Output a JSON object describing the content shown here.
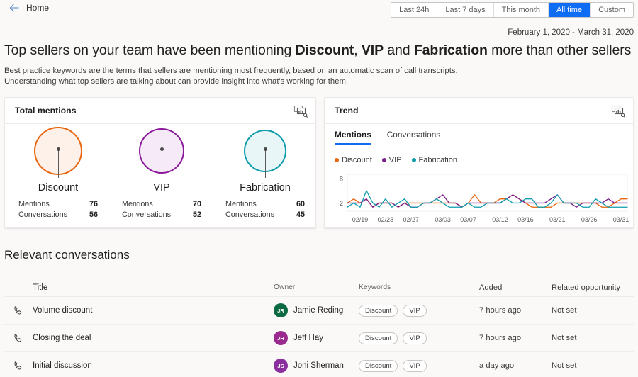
{
  "topbar": {
    "back_label": "Home",
    "back_icon": "arrow-left-icon",
    "date_filters": [
      {
        "label": "Last 24h",
        "active": false
      },
      {
        "label": "Last 7 days",
        "active": false
      },
      {
        "label": "This month",
        "active": false
      },
      {
        "label": "All time",
        "active": true
      },
      {
        "label": "Custom",
        "active": false
      }
    ],
    "date_range": "February 1, 2020 - March 31, 2020",
    "accent_color": "#0f6cf5"
  },
  "headline": {
    "prefix": "Top sellers on your team have been mentioning ",
    "kw1": "Discount",
    "sep1": ", ",
    "kw2": "VIP",
    "sep2": " and ",
    "kw3": "Fabrication",
    "suffix": " more than other sellers"
  },
  "subtext": {
    "line1": "Best practice keywords are the terms that sellers are mentioning most frequently, based on an automatic scan of call transcripts.",
    "line2": "Understanding what top sellers are talking about can provide insight into what's working for them."
  },
  "total_mentions_card": {
    "title": "Total mentions",
    "action_icon": "copy-chart-icon",
    "labels": {
      "mentions": "Mentions",
      "conversations": "Conversations"
    },
    "keywords": [
      {
        "name": "Discount",
        "mentions": 76,
        "conversations": 56,
        "color": "#e8650d",
        "fill": "#fdf1ea",
        "size": 68
      },
      {
        "name": "VIP",
        "mentions": 70,
        "conversations": 52,
        "color": "#8b1a9b",
        "fill": "#f6eaf8",
        "size": 64
      },
      {
        "name": "Fabrication",
        "mentions": 60,
        "conversations": 45,
        "color": "#0f9dac",
        "fill": "#e8f6f8",
        "size": 60
      }
    ]
  },
  "trend_card": {
    "title": "Trend",
    "action_icon": "copy-chart-icon",
    "tabs": [
      {
        "label": "Mentions",
        "active": true
      },
      {
        "label": "Conversations",
        "active": false
      }
    ]
  },
  "chart_data": {
    "type": "line",
    "title": "Trend",
    "xlabel": "",
    "ylabel": "",
    "ylim": [
      0,
      9
    ],
    "yticks": [
      2,
      8
    ],
    "grid": false,
    "legend_position": "top-left",
    "x": [
      "02/17",
      "02/18",
      "02/19",
      "02/20",
      "02/21",
      "02/22",
      "02/23",
      "02/24",
      "02/25",
      "02/26",
      "02/27",
      "02/28",
      "02/29",
      "03/01",
      "03/02",
      "03/03",
      "03/04",
      "03/05",
      "03/06",
      "03/07",
      "03/08",
      "03/09",
      "03/10",
      "03/11",
      "03/12",
      "03/13",
      "03/14",
      "03/15",
      "03/16",
      "03/17",
      "03/18",
      "03/19",
      "03/20",
      "03/21",
      "03/22",
      "03/23",
      "03/24",
      "03/25",
      "03/26",
      "03/27",
      "03/28",
      "03/29",
      "03/30",
      "03/31",
      "04/01"
    ],
    "xticks": [
      "02/19",
      "02/23",
      "02/27",
      "03/03",
      "03/07",
      "03/12",
      "03/16",
      "03/21",
      "03/26",
      "03/31"
    ],
    "series": [
      {
        "name": "Discount",
        "color": "#e8650d",
        "values": [
          2,
          3,
          2,
          3,
          1,
          2,
          2,
          2,
          1,
          2,
          2,
          2,
          2,
          2,
          2,
          2,
          2,
          2,
          1,
          2,
          4,
          2,
          2,
          2,
          3,
          3,
          4,
          3,
          2,
          1,
          1,
          1,
          1,
          2,
          2,
          2,
          2,
          2,
          2,
          2,
          1,
          1,
          2,
          3,
          3
        ]
      },
      {
        "name": "VIP",
        "color": "#7a1b8c",
        "values": [
          2,
          2,
          2,
          3,
          1,
          2,
          2,
          2,
          1,
          2,
          1,
          1,
          2,
          2,
          3,
          4,
          2,
          2,
          1,
          2,
          2,
          2,
          2,
          2,
          2,
          3,
          4,
          3,
          2,
          2,
          2,
          2,
          3,
          4,
          2,
          2,
          1,
          2,
          2,
          2,
          2,
          3,
          2,
          2,
          2
        ]
      },
      {
        "name": "Fabrication",
        "color": "#0f9dac",
        "values": [
          1,
          2,
          1,
          5,
          2,
          1,
          3,
          1,
          2,
          3,
          1,
          1,
          2,
          2,
          3,
          2,
          1,
          1,
          1,
          2,
          1,
          1,
          2,
          2,
          2,
          3,
          2,
          2,
          3,
          3,
          1,
          1,
          2,
          4,
          2,
          2,
          2,
          1,
          1,
          3,
          2,
          1,
          1,
          1,
          1
        ]
      }
    ]
  },
  "table": {
    "section_title": "Relevant conversations",
    "columns": [
      "Title",
      "Owner",
      "Keywords",
      "Added",
      "Related opportunity"
    ],
    "rows": [
      {
        "icon": "phone-icon",
        "title": "Volume discount",
        "owner": "Jamie Reding",
        "initials": "JR",
        "avatar_color": "#0b6a41",
        "keywords": [
          "Discount",
          "VIP"
        ],
        "added": "7 hours ago",
        "opportunity": "Not set"
      },
      {
        "icon": "phone-icon",
        "title": "Closing the deal",
        "owner": "Jeff Hay",
        "initials": "JH",
        "avatar_color": "#9b2a8e",
        "keywords": [
          "Discount",
          "VIP"
        ],
        "added": "7 hours ago",
        "opportunity": "Not set"
      },
      {
        "icon": "phone-icon",
        "title": "Initial discussion",
        "owner": "Joni Sherman",
        "initials": "JS",
        "avatar_color": "#8b2f9e",
        "keywords": [
          "Discount",
          "VIP"
        ],
        "added": "a day ago",
        "opportunity": "Not set"
      }
    ]
  }
}
